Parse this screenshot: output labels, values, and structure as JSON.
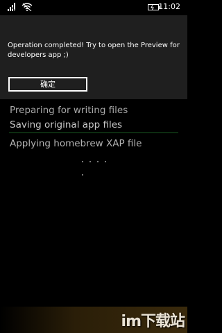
{
  "status_bar": {
    "time": "11:02",
    "icons": [
      "signal-icon",
      "wifi-icon",
      "battery-icon"
    ]
  },
  "dialog": {
    "message": "Operation completed! Try to open the Preview for developers app ;)",
    "confirm_label": "确定"
  },
  "progress": {
    "steps": [
      "Preparing for writing files",
      "Saving original app files",
      "Applying homebrew XAP file"
    ]
  },
  "watermark": {
    "text": "im下载站"
  },
  "colors": {
    "dialog_background": "#1f1f1f",
    "progress_line": "#1a5a22",
    "text": "#ffffff"
  }
}
